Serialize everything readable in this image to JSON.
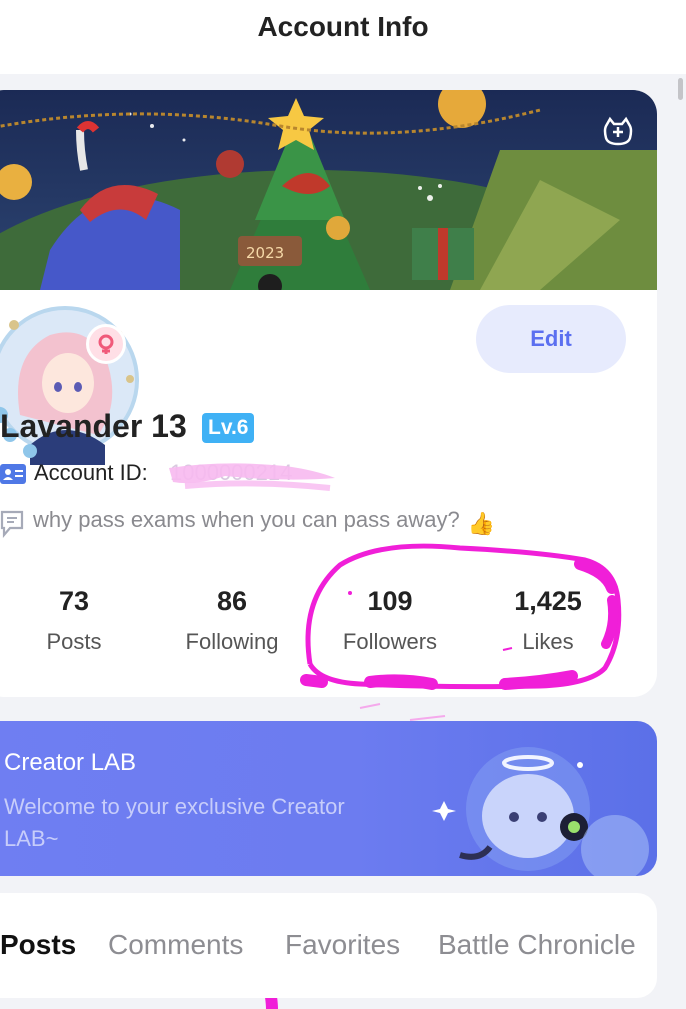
{
  "header": {
    "title": "Account Info"
  },
  "profile": {
    "edit_label": "Edit",
    "username": "Lavander 13",
    "level": "Lv.6",
    "account_id_label": "Account ID:",
    "account_id_value": "1000000214",
    "bio": "why pass exams when you can pass away?",
    "bio_emoji": "👍"
  },
  "stats": [
    {
      "value": "73",
      "label": "Posts"
    },
    {
      "value": "86",
      "label": "Following"
    },
    {
      "value": "109",
      "label": "Followers"
    },
    {
      "value": "1,425",
      "label": "Likes"
    }
  ],
  "creator_lab": {
    "title": "Creator LAB",
    "subtitle": "Welcome to your exclusive Creator LAB~"
  },
  "tabs": [
    {
      "label": "Posts",
      "active": true
    },
    {
      "label": "Comments",
      "active": false
    },
    {
      "label": "Favorites",
      "active": false
    },
    {
      "label": "Battle Chronicle",
      "active": false
    }
  ],
  "colors": {
    "accent": "#5b6ff0",
    "level_badge": "#3fb1f5",
    "creator_banner": "#6c7cf0",
    "annotation": "#f01fd8"
  },
  "icons": {
    "banner_action": "gamepad-face-icon",
    "gender": "female-icon",
    "id_card": "id-card-icon",
    "bio": "speech-bubble-icon"
  }
}
